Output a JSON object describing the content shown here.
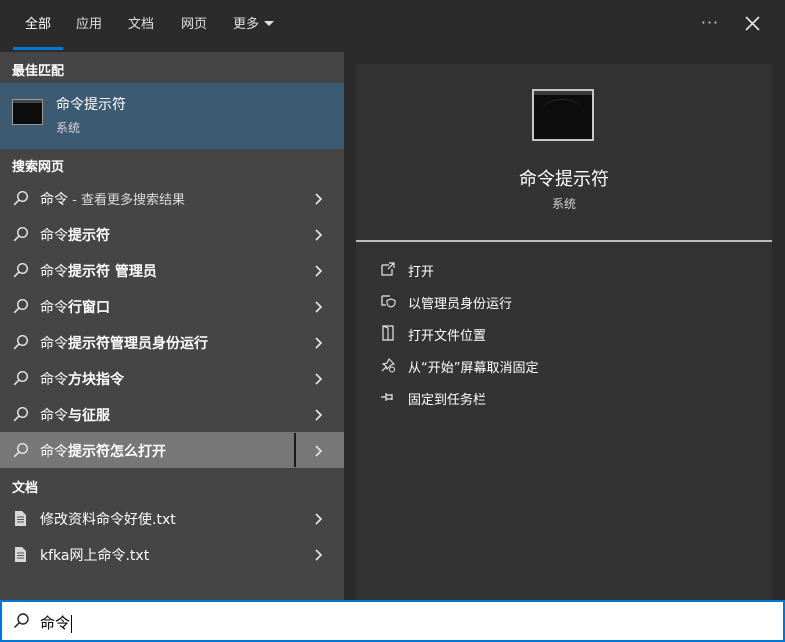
{
  "tabs": [
    {
      "label": "全部",
      "active": true
    },
    {
      "label": "应用",
      "active": false
    },
    {
      "label": "文档",
      "active": false
    },
    {
      "label": "网页",
      "active": false
    },
    {
      "label": "更多",
      "active": false
    }
  ],
  "header": {
    "ellipsis": "···"
  },
  "colors": {
    "accent": "#0078d7",
    "selection": "#3d5a73",
    "hover": "#777777"
  },
  "best_match": {
    "header": "最佳匹配",
    "title": "命令提示符",
    "subtitle": "系统",
    "icon": "terminal-icon"
  },
  "web_search": {
    "header": "搜索网页",
    "items": [
      {
        "prefix": "命令",
        "suffix": " - 查看更多搜索结果",
        "suffix_muted": true
      },
      {
        "prefix": "命令",
        "suffix": "提示符"
      },
      {
        "prefix": "命令",
        "suffix": "提示符 管理员"
      },
      {
        "prefix": "命令",
        "suffix": "行窗口"
      },
      {
        "prefix": "命令",
        "suffix": "提示符管理员身份运行"
      },
      {
        "prefix": "命令",
        "suffix": "方块指令"
      },
      {
        "prefix": "命令",
        "suffix": "与征服"
      },
      {
        "prefix": "命令",
        "suffix": "提示符怎么打开",
        "highlighted": true
      }
    ]
  },
  "documents": {
    "header": "文档",
    "items": [
      {
        "label": "修改资料命令好使.txt",
        "icon": "document-icon"
      },
      {
        "label": "kfka网上命令.txt",
        "icon": "document-icon"
      }
    ]
  },
  "preview": {
    "title": "命令提示符",
    "subtitle": "系统",
    "actions": [
      {
        "label": "打开",
        "icon": "open-icon"
      },
      {
        "label": "以管理员身份运行",
        "icon": "shield-icon"
      },
      {
        "label": "打开文件位置",
        "icon": "folder-location-icon"
      },
      {
        "label": "从“开始”屏幕取消固定",
        "icon": "unpin-icon"
      },
      {
        "label": "固定到任务栏",
        "icon": "pin-icon"
      }
    ]
  },
  "search": {
    "value": "命令"
  }
}
